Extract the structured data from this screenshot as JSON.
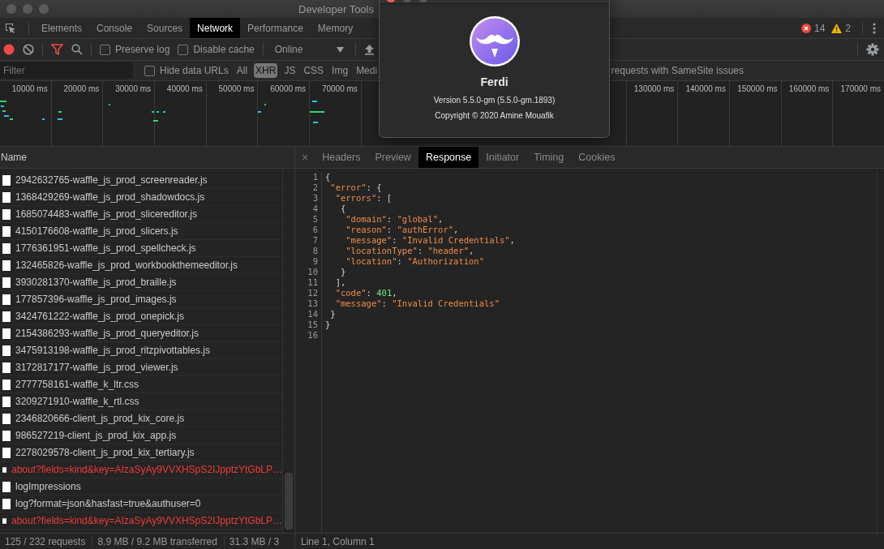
{
  "window": {
    "title": "Developer Tools"
  },
  "panel_tabs": [
    {
      "label": "Elements",
      "selected": false
    },
    {
      "label": "Console",
      "selected": false
    },
    {
      "label": "Sources",
      "selected": false
    },
    {
      "label": "Network",
      "selected": true
    },
    {
      "label": "Performance",
      "selected": false
    },
    {
      "label": "Memory",
      "selected": false
    }
  ],
  "issues": {
    "errors": "14",
    "warnings": "2"
  },
  "toolbar": {
    "recording": true,
    "filter_active": true,
    "preserve_log": {
      "label": "Preserve log",
      "checked": false
    },
    "disable_cache": {
      "label": "Disable cache",
      "checked": false
    },
    "throttling": "Online"
  },
  "filter_bar": {
    "placeholder": "Filter",
    "hide_data_urls": {
      "label": "Hide data URLs",
      "checked": false
    },
    "types": [
      {
        "label": "All",
        "selected": false
      },
      {
        "label": "XHR",
        "selected": true
      },
      {
        "label": "JS",
        "selected": false
      },
      {
        "label": "CSS",
        "selected": false
      },
      {
        "label": "Img",
        "selected": false
      },
      {
        "label": "Medi",
        "selected": false
      }
    ],
    "samesite_label": "requests with SameSite issues"
  },
  "timeline": {
    "left_ticks": [
      "10000 ms",
      "20000 ms",
      "30000 ms",
      "40000 ms",
      "50000 ms",
      "60000 ms",
      "70000 ms"
    ],
    "right_ticks": [
      "130000 ms",
      "140000 ms",
      "150000 ms",
      "160000 ms",
      "170000 ms"
    ]
  },
  "requests": {
    "column": "Name",
    "rows": [
      {
        "name": "2942632765-waffle_js_prod_screenreader.js",
        "failed": false
      },
      {
        "name": "1368429269-waffle_js_prod_shadowdocs.js",
        "failed": false
      },
      {
        "name": "1685074483-waffle_js_prod_slicereditor.js",
        "failed": false
      },
      {
        "name": "4150176608-waffle_js_prod_slicers.js",
        "failed": false
      },
      {
        "name": "1776361951-waffle_js_prod_spellcheck.js",
        "failed": false
      },
      {
        "name": "132465826-waffle_js_prod_workbookthemeeditor.js",
        "failed": false
      },
      {
        "name": "3930281370-waffle_js_prod_braille.js",
        "failed": false
      },
      {
        "name": "177857396-waffle_js_prod_images.js",
        "failed": false
      },
      {
        "name": "3424761222-waffle_js_prod_onepick.js",
        "failed": false
      },
      {
        "name": "2154386293-waffle_js_prod_queryeditor.js",
        "failed": false
      },
      {
        "name": "3475913198-waffle_js_prod_ritzpivottables.js",
        "failed": false
      },
      {
        "name": "3172817177-waffle_js_prod_viewer.js",
        "failed": false
      },
      {
        "name": "2777758161-waffle_k_ltr.css",
        "failed": false
      },
      {
        "name": "3209271910-waffle_k_rtl.css",
        "failed": false
      },
      {
        "name": "2346820666-client_js_prod_kix_core.js",
        "failed": false
      },
      {
        "name": "986527219-client_js_prod_kix_app.js",
        "failed": false
      },
      {
        "name": "2278029578-client_js_prod_kix_tertiary.js",
        "failed": false
      },
      {
        "name": "about?fields=kind&key=AIzaSyAy9VVXHSpS2IJpptzYtGbLP…",
        "failed": true
      },
      {
        "name": "logImpressions",
        "failed": false
      },
      {
        "name": "log?format=json&hasfast=true&authuser=0",
        "failed": false
      },
      {
        "name": "about?fields=kind&key=AIzaSyAy9VVXHSpS2IJpptzYtGbLP…",
        "failed": true
      }
    ]
  },
  "detail_tabs": [
    {
      "label": "Headers",
      "selected": false
    },
    {
      "label": "Preview",
      "selected": false
    },
    {
      "label": "Response",
      "selected": true
    },
    {
      "label": "Initiator",
      "selected": false
    },
    {
      "label": "Timing",
      "selected": false
    },
    {
      "label": "Cookies",
      "selected": false
    }
  ],
  "close_label": "×",
  "response_lines": [
    {
      "number": "1",
      "tokens": [
        {
          "kind": "punct",
          "text": "{"
        }
      ]
    },
    {
      "number": "2",
      "tokens": [
        {
          "kind": "key",
          "text": " \"error\""
        },
        {
          "kind": "punct",
          "text": ": {"
        }
      ]
    },
    {
      "number": "3",
      "tokens": [
        {
          "kind": "key",
          "text": "  \"errors\""
        },
        {
          "kind": "punct",
          "text": ": ["
        }
      ]
    },
    {
      "number": "4",
      "tokens": [
        {
          "kind": "punct",
          "text": "   {"
        }
      ]
    },
    {
      "number": "5",
      "tokens": [
        {
          "kind": "key",
          "text": "    \"domain\""
        },
        {
          "kind": "punct",
          "text": ": "
        },
        {
          "kind": "string",
          "text": "\"global\""
        },
        {
          "kind": "punct",
          "text": ","
        }
      ]
    },
    {
      "number": "6",
      "tokens": [
        {
          "kind": "key",
          "text": "    \"reason\""
        },
        {
          "kind": "punct",
          "text": ": "
        },
        {
          "kind": "string",
          "text": "\"authError\""
        },
        {
          "kind": "punct",
          "text": ","
        }
      ]
    },
    {
      "number": "7",
      "tokens": [
        {
          "kind": "key",
          "text": "    \"message\""
        },
        {
          "kind": "punct",
          "text": ": "
        },
        {
          "kind": "string",
          "text": "\"Invalid Credentials\""
        },
        {
          "kind": "punct",
          "text": ","
        }
      ]
    },
    {
      "number": "8",
      "tokens": [
        {
          "kind": "key",
          "text": "    \"locationType\""
        },
        {
          "kind": "punct",
          "text": ": "
        },
        {
          "kind": "string",
          "text": "\"header\""
        },
        {
          "kind": "punct",
          "text": ","
        }
      ]
    },
    {
      "number": "9",
      "tokens": [
        {
          "kind": "key",
          "text": "    \"location\""
        },
        {
          "kind": "punct",
          "text": ": "
        },
        {
          "kind": "string",
          "text": "\"Authorization\""
        }
      ]
    },
    {
      "number": "10",
      "tokens": [
        {
          "kind": "punct",
          "text": "   }"
        }
      ]
    },
    {
      "number": "11",
      "tokens": [
        {
          "kind": "punct",
          "text": "  ],"
        }
      ]
    },
    {
      "number": "12",
      "tokens": [
        {
          "kind": "key",
          "text": "  \"code\""
        },
        {
          "kind": "punct",
          "text": ": "
        },
        {
          "kind": "number",
          "text": "401"
        },
        {
          "kind": "punct",
          "text": ","
        }
      ]
    },
    {
      "number": "13",
      "tokens": [
        {
          "kind": "key",
          "text": "  \"message\""
        },
        {
          "kind": "punct",
          "text": ": "
        },
        {
          "kind": "string",
          "text": "\"Invalid Credentials\""
        }
      ]
    },
    {
      "number": "14",
      "tokens": [
        {
          "kind": "punct",
          "text": " }"
        }
      ]
    },
    {
      "number": "15",
      "tokens": [
        {
          "kind": "punct",
          "text": "}"
        }
      ]
    },
    {
      "number": "16"
    }
  ],
  "status_bar": {
    "left": [
      "125 / 232 requests",
      "8.9 MB / 9.2 MB transferred",
      "31.3 MB / 3"
    ],
    "right": "Line 1, Column 1"
  },
  "about_dialog": {
    "app_name": "Ferdi",
    "version": "Version 5.5.0-gm (5.5.0-gm.1893)",
    "copyright": "Copyright © 2020 Amine Mouafik"
  }
}
